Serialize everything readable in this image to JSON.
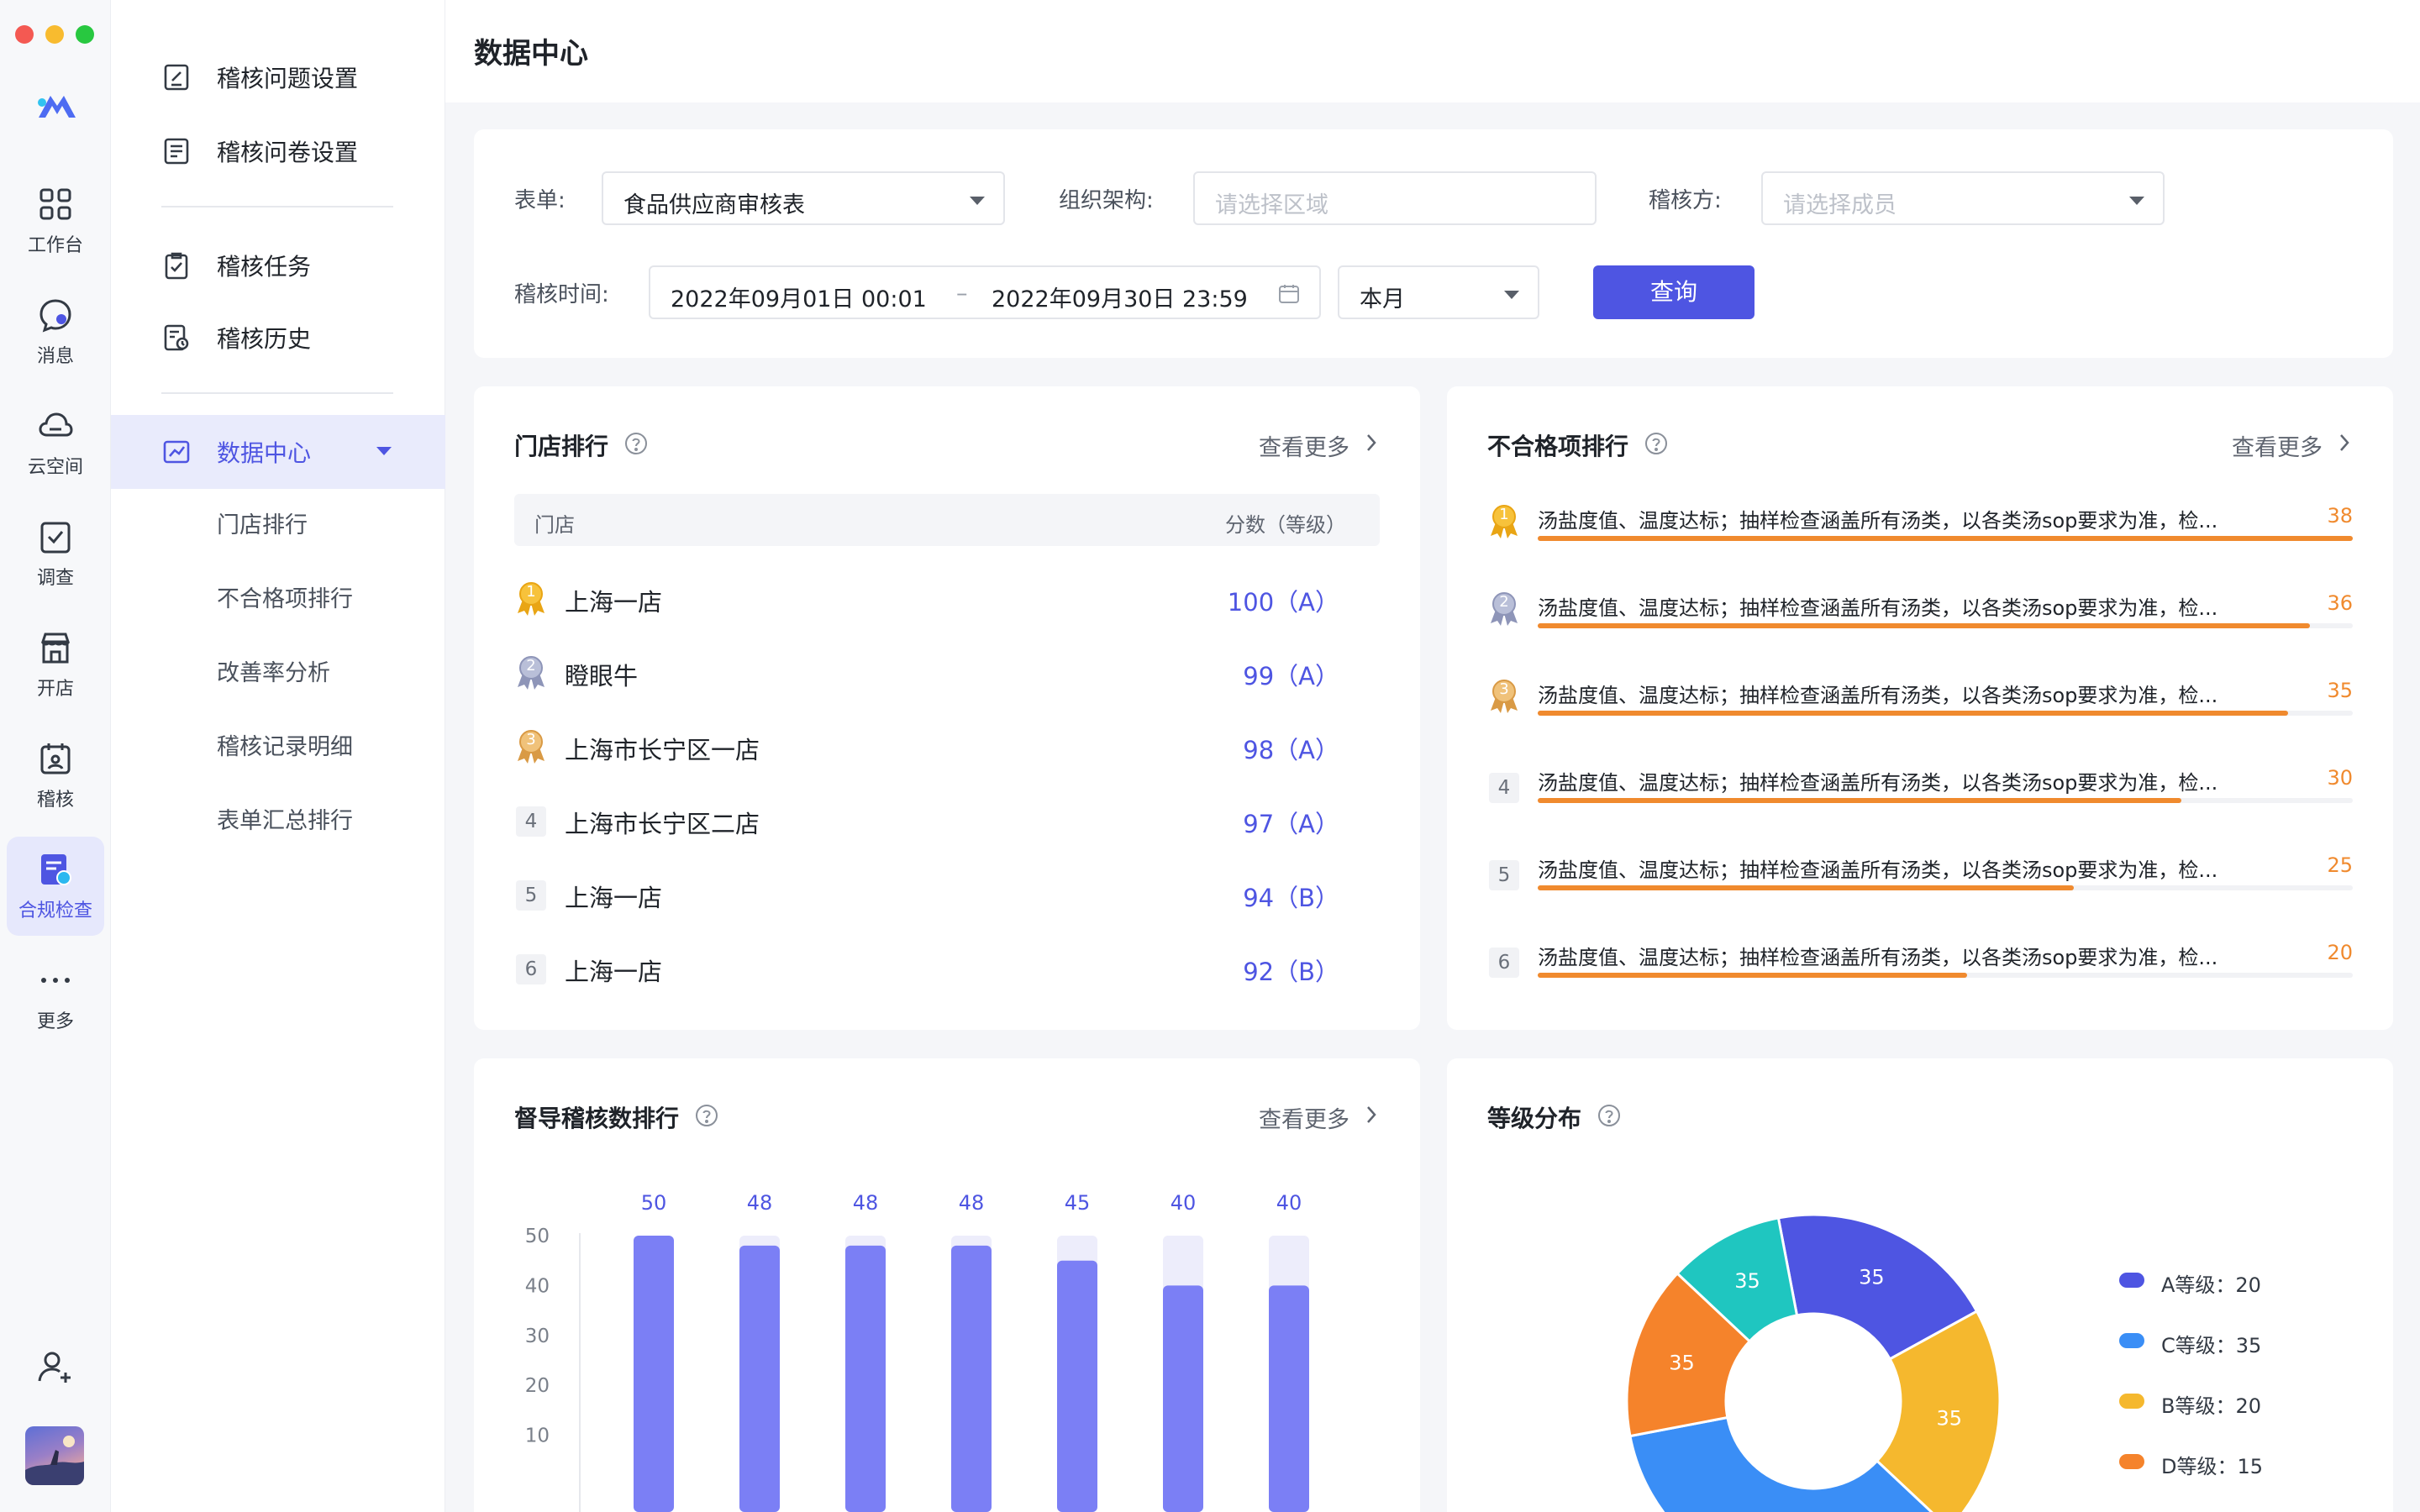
{
  "rail": {
    "items": [
      {
        "label": "工作台",
        "icon": "grid-icon"
      },
      {
        "label": "消息",
        "icon": "message-icon"
      },
      {
        "label": "云空间",
        "icon": "cloud-icon"
      },
      {
        "label": "调查",
        "icon": "survey-icon"
      },
      {
        "label": "开店",
        "icon": "store-icon"
      },
      {
        "label": "稽核",
        "icon": "audit-icon"
      },
      {
        "label": "合规检查",
        "icon": "compliance-icon",
        "active": true
      },
      {
        "label": "更多",
        "icon": "more-icon"
      }
    ]
  },
  "menu": {
    "top_items": [
      {
        "label": "稽核问题设置",
        "icon": "edit-doc-icon"
      },
      {
        "label": "稽核问卷设置",
        "icon": "questionnaire-icon"
      }
    ],
    "mid_items": [
      {
        "label": "稽核任务",
        "icon": "clipboard-check-icon"
      },
      {
        "label": "稽核历史",
        "icon": "history-doc-icon"
      }
    ],
    "active_item": {
      "label": "数据中心",
      "icon": "chart-icon"
    },
    "sub_items": [
      "门店排行",
      "不合格项排行",
      "改善率分析",
      "稽核记录明细",
      "表单汇总排行"
    ]
  },
  "header": {
    "title": "数据中心"
  },
  "filter": {
    "form_label": "表单:",
    "form_value": "食品供应商审核表",
    "org_label": "组织架构:",
    "org_placeholder": "请选择区域",
    "auditor_label": "稽核方:",
    "auditor_placeholder": "请选择成员",
    "time_label": "稽核时间:",
    "time_start": "2022年09月01日 00:01",
    "time_sep": "–",
    "time_end": "2022年09月30日 23:59",
    "period_value": "本月",
    "query_button": "查询"
  },
  "store_rank": {
    "title": "门店排行",
    "more": "查看更多",
    "col_store": "门店",
    "col_score": "分数（等级）",
    "rows": [
      {
        "rank": "1",
        "name": "上海一店",
        "score": "100（A）",
        "medal": "gold"
      },
      {
        "rank": "2",
        "name": "瞪眼牛",
        "score": "99（A）",
        "medal": "silver"
      },
      {
        "rank": "3",
        "name": "上海市长宁区一店",
        "score": "98（A）",
        "medal": "bronze"
      },
      {
        "rank": "4",
        "name": "上海市长宁区二店",
        "score": "97（A）"
      },
      {
        "rank": "5",
        "name": "上海一店",
        "score": "94（B）"
      },
      {
        "rank": "6",
        "name": "上海一店",
        "score": "92（B）"
      }
    ]
  },
  "nonconform_rank": {
    "title": "不合格项排行",
    "more": "查看更多",
    "max": 38,
    "rows": [
      {
        "rank": "1",
        "text": "汤盐度值、温度达标；抽样检查涵盖所有汤类，以各类汤sop要求为准，检...",
        "count": 38,
        "medal": "gold"
      },
      {
        "rank": "2",
        "text": "汤盐度值、温度达标；抽样检查涵盖所有汤类，以各类汤sop要求为准，检...",
        "count": 36,
        "medal": "silver"
      },
      {
        "rank": "3",
        "text": "汤盐度值、温度达标；抽样检查涵盖所有汤类，以各类汤sop要求为准，检...",
        "count": 35,
        "medal": "bronze"
      },
      {
        "rank": "4",
        "text": "汤盐度值、温度达标；抽样检查涵盖所有汤类，以各类汤sop要求为准，检...",
        "count": 30
      },
      {
        "rank": "5",
        "text": "汤盐度值、温度达标；抽样检查涵盖所有汤类，以各类汤sop要求为准，检...",
        "count": 25
      },
      {
        "rank": "6",
        "text": "汤盐度值、温度达标；抽样检查涵盖所有汤类，以各类汤sop要求为准，检...",
        "count": 20
      }
    ]
  },
  "supervisor_rank": {
    "title": "督导稽核数排行",
    "more": "查看更多"
  },
  "grade_dist": {
    "title": "等级分布"
  },
  "chart_data": [
    {
      "type": "bar",
      "values": [
        50,
        48,
        48,
        48,
        45,
        40,
        40
      ],
      "yticks": [
        50,
        40,
        30,
        20,
        10
      ],
      "ylim": [
        0,
        50
      ],
      "color": "#7b7ff5",
      "track_color": "#ededfb"
    },
    {
      "type": "pie",
      "donut": true,
      "slices": [
        {
          "label": "A等级",
          "value": 20,
          "slice_label": "35",
          "color": "#4e55e2"
        },
        {
          "label": "B等级",
          "value": 20,
          "slice_label": "35",
          "color": "#f5b82e"
        },
        {
          "label": "C等级",
          "value": 35,
          "slice_label": "",
          "color": "#3a8ef6"
        },
        {
          "label": "D等级",
          "value": 15,
          "slice_label": "35",
          "color": "#f5832b"
        },
        {
          "label": "",
          "value": 10,
          "slice_label": "35",
          "color": "#1fc6c0"
        }
      ],
      "legend": [
        {
          "text": "A等级：20",
          "color": "#4e55e2"
        },
        {
          "text": "C等级：35",
          "color": "#3a8ef6"
        },
        {
          "text": "B等级：20",
          "color": "#f5b82e"
        },
        {
          "text": "D等级：15",
          "color": "#f5832b"
        }
      ]
    }
  ]
}
